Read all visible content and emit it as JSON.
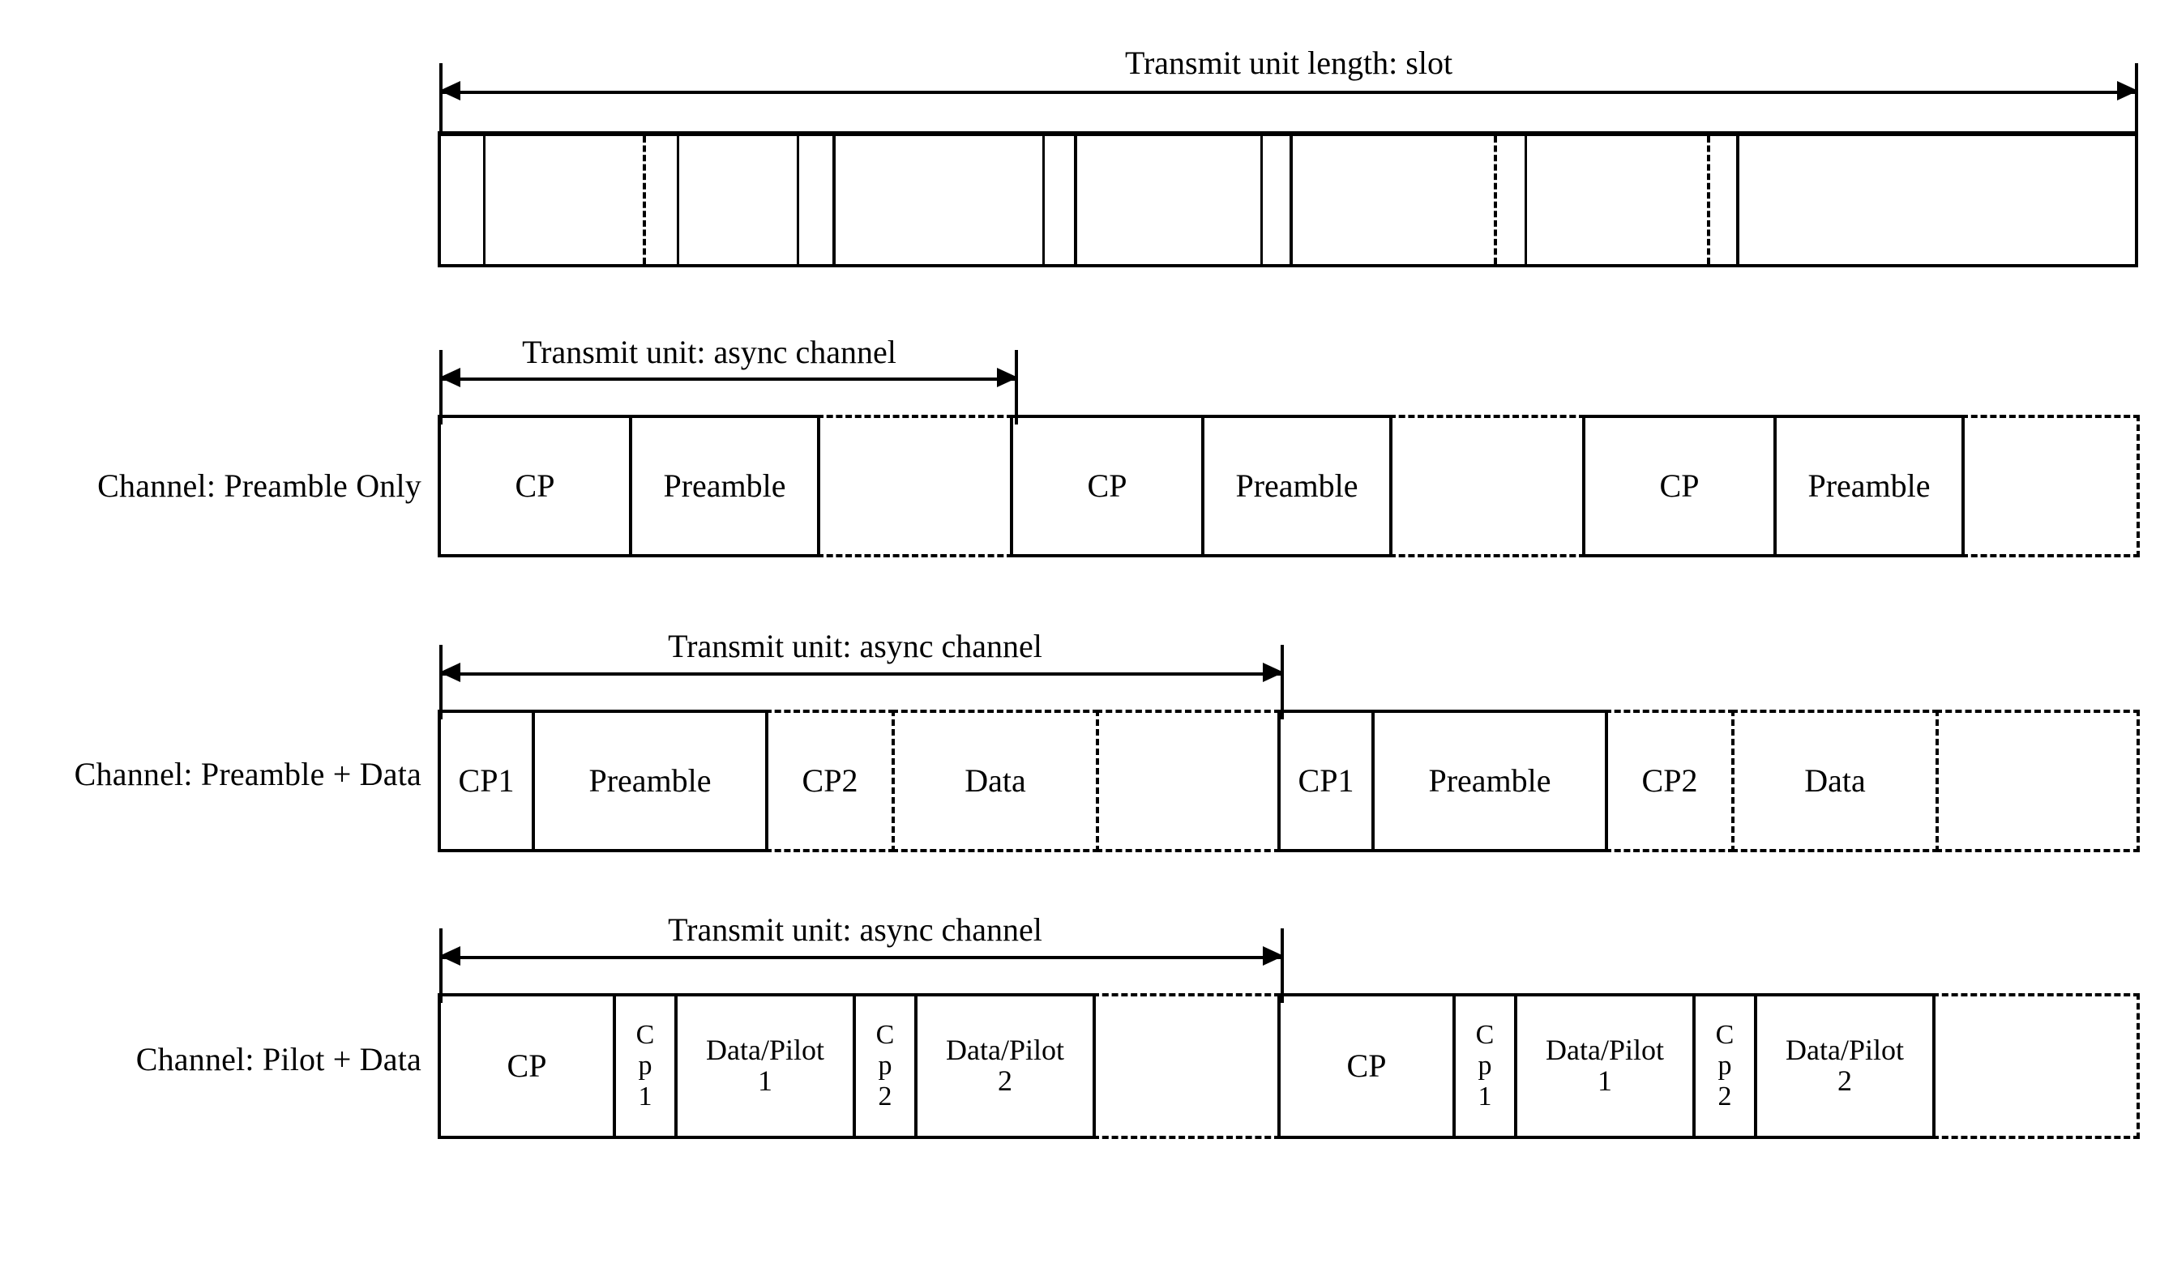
{
  "figure": {
    "type": "timing-diagram",
    "description": "Frame structure timing diagram showing a transmit slot subdivided into async channel transmit units for three channel configurations."
  },
  "slot_row": {
    "measure_label": "Transmit unit length: slot",
    "segments_note": "Slot subdivided by vertical boundary lines (solid and dashed)."
  },
  "rows": [
    {
      "id": "preamble-only",
      "label": "Channel: Preamble Only",
      "measure_label": "Transmit unit: async channel",
      "cells": [
        {
          "text": "CP",
          "style": "solid"
        },
        {
          "text": "Preamble",
          "style": "solid"
        },
        {
          "text": "",
          "style": "dashed"
        },
        {
          "text": "CP",
          "style": "solid"
        },
        {
          "text": "Preamble",
          "style": "solid"
        },
        {
          "text": "",
          "style": "dashed"
        },
        {
          "text": "CP",
          "style": "solid"
        },
        {
          "text": "Preamble",
          "style": "solid"
        },
        {
          "text": "",
          "style": "dashed"
        }
      ]
    },
    {
      "id": "preamble-data",
      "label": "Channel: Preamble + Data",
      "measure_label": "Transmit unit: async channel",
      "cells": [
        {
          "text": "CP1",
          "style": "solid"
        },
        {
          "text": "Preamble",
          "style": "solid"
        },
        {
          "text": "CP2",
          "style": "dashed"
        },
        {
          "text": "Data",
          "style": "dashed"
        },
        {
          "text": "",
          "style": "dashed"
        },
        {
          "text": "CP1",
          "style": "solid"
        },
        {
          "text": "Preamble",
          "style": "solid"
        },
        {
          "text": "CP2",
          "style": "dashed"
        },
        {
          "text": "Data",
          "style": "dashed"
        },
        {
          "text": "",
          "style": "dashed"
        }
      ]
    },
    {
      "id": "pilot-data",
      "label": "Channel: Pilot + Data",
      "measure_label": "Transmit unit: async channel",
      "cells": [
        {
          "text": "CP",
          "style": "solid"
        },
        {
          "text": "C\np\n1",
          "style": "solid"
        },
        {
          "text": "Data/Pilot\n1",
          "style": "solid"
        },
        {
          "text": "C\np\n2",
          "style": "solid"
        },
        {
          "text": "Data/Pilot\n2",
          "style": "solid"
        },
        {
          "text": "",
          "style": "dashed"
        },
        {
          "text": "CP",
          "style": "solid"
        },
        {
          "text": "C\np\n1",
          "style": "solid"
        },
        {
          "text": "Data/Pilot\n1",
          "style": "solid"
        },
        {
          "text": "C\np\n2",
          "style": "solid"
        },
        {
          "text": "Data/Pilot\n2",
          "style": "solid"
        },
        {
          "text": "",
          "style": "dashed"
        }
      ]
    }
  ],
  "colors": {
    "ink": "#000000",
    "paper": "#ffffff"
  }
}
